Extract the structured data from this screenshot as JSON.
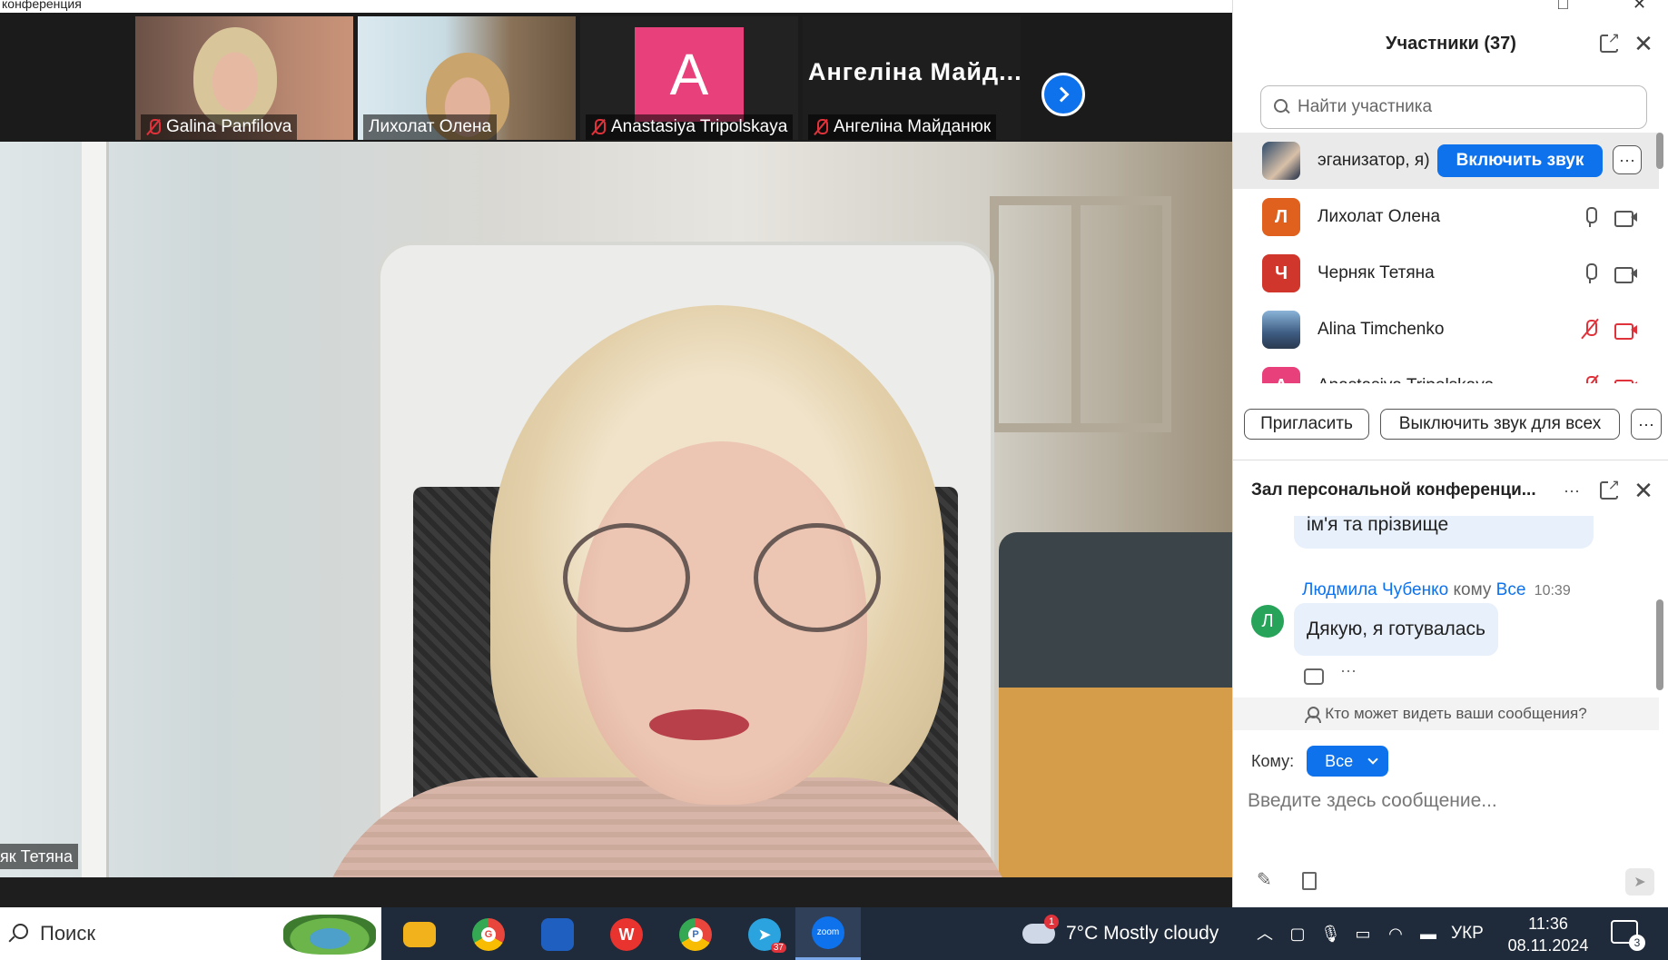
{
  "window": {
    "title": "конференция"
  },
  "gallery": {
    "thumbnails": [
      {
        "name": "Galina Panfilova",
        "muted": true
      },
      {
        "name": "Лихолат Олена",
        "muted": false
      },
      {
        "name": "Anastasiya Tripolskaya",
        "muted": true,
        "avatar_letter": "A",
        "avatar_color": "#e8407b"
      },
      {
        "name": "Ангеліна Майданюк",
        "muted": true,
        "display_name": "Ангеліна  Майд..."
      }
    ]
  },
  "main_video": {
    "speaker_label": "як Тетяна"
  },
  "participants": {
    "title": "Участники (37)",
    "search_placeholder": "Найти участника",
    "rows": [
      {
        "name": "эганизатор, я)",
        "action": "Включить звук",
        "more": "···"
      },
      {
        "name": "Лихолат Олена",
        "avatar": "Л",
        "avatar_color": "#e0601e",
        "mic": "on",
        "camera": "off"
      },
      {
        "name": "Черняк Тетяна",
        "avatar": "Ч",
        "avatar_color": "#d0362b",
        "mic": "on",
        "camera": "off"
      },
      {
        "name": "Alina Timchenko",
        "mic": "muted",
        "camera": "muted"
      },
      {
        "name": "Anastasiya Tripolskaya",
        "avatar": "A",
        "avatar_color": "#e8407b",
        "mic": "muted",
        "camera": "muted"
      }
    ],
    "invite_label": "Пригласить",
    "mute_all_label": "Выключить звук для всех",
    "more_label": "···"
  },
  "chat": {
    "title": "Зал персональной конференци...",
    "more_label": "···",
    "messages": [
      {
        "text": "ім'я та прізвище"
      },
      {
        "sender": "Людмила Чубенко",
        "to_word": "кому",
        "to": "Все",
        "time": "10:39",
        "avatar": "Л",
        "text": "Дякую, я готувалась"
      }
    ],
    "message_more": "···",
    "visibility_text": "Кто может видеть ваши сообщения?",
    "to_label": "Кому:",
    "to_value": "Все",
    "input_placeholder": "Введите здесь сообщение..."
  },
  "taskbar": {
    "search_text": "Поиск",
    "apps": [
      {
        "name": "file-explorer",
        "color": "#f2b21b"
      },
      {
        "name": "chrome-g",
        "color": "#e8453c",
        "badge": "G"
      },
      {
        "name": "save-app",
        "color": "#1e5fbf"
      },
      {
        "name": "wps-office",
        "color": "#e8332f",
        "glyph": "W"
      },
      {
        "name": "chrome-p",
        "color": "#e8453c",
        "badge": "P"
      },
      {
        "name": "telegram",
        "color": "#2aa3de",
        "badge": "37"
      },
      {
        "name": "zoom",
        "color": "#0e72ed",
        "glyph": "zoom"
      }
    ],
    "weather_badge": "1",
    "weather": "7°C  Mostly cloudy",
    "lang": "УКР",
    "time": "11:36",
    "date": "08.11.2024",
    "notifications": "3"
  }
}
